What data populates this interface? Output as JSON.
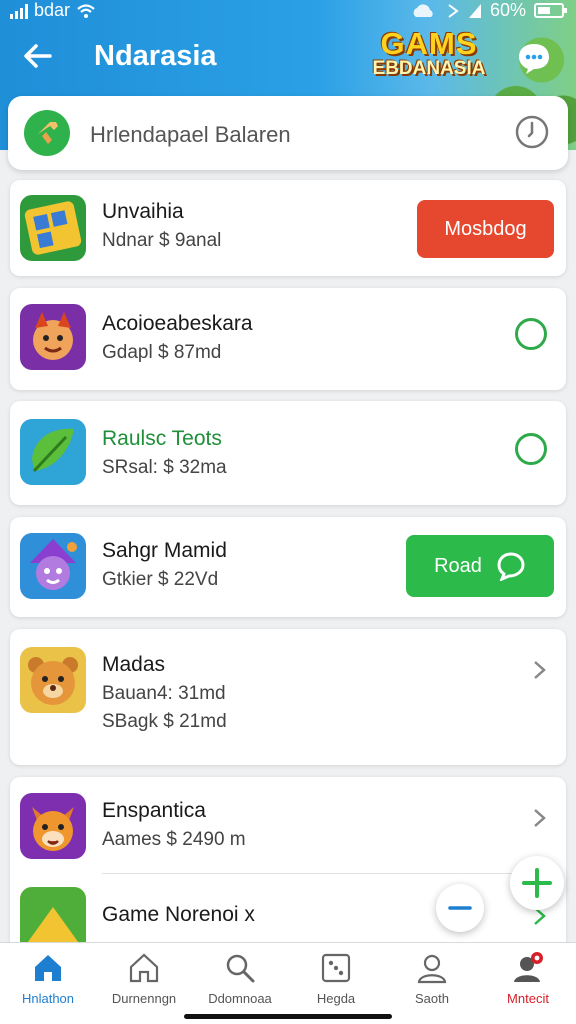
{
  "status_bar": {
    "carrier": "bdar",
    "battery": "60%"
  },
  "header": {
    "title": "Ndarasia",
    "logo_line1": "GAMS",
    "logo_line2": "EBDANASIA"
  },
  "search": {
    "text": "Hrlendapael Balaren"
  },
  "apps": [
    {
      "name": "Unvaihia",
      "meta": [
        "Ndnar $ 9anal"
      ],
      "action": "button",
      "button_label": "Mosbdog",
      "button_color": "#e6482f"
    },
    {
      "name": "Acoioeabeskara",
      "meta": [
        "Gdapl $ 87md"
      ],
      "action": "circle"
    },
    {
      "name": "Raulsc Teots",
      "meta": [
        "SRsal: $ 32ma"
      ],
      "action": "circle",
      "name_color": "#1f8f3a"
    },
    {
      "name": "Sahgr Mamid",
      "meta": [
        "Gtkier $ 22Vd"
      ],
      "action": "button",
      "button_label": "Road",
      "button_color": "#2cba4a"
    },
    {
      "name": "Madas",
      "meta": [
        "Bauan4: 31md",
        "SBagk $ 21md"
      ],
      "action": "chevron"
    },
    {
      "name": "Enspantica",
      "meta": [
        "Aames $ 2490 m"
      ],
      "action": "chevron"
    },
    {
      "name": "Game Norenoi x",
      "meta": [],
      "action": "chevron"
    }
  ],
  "nav": [
    {
      "label": "Hnlathon",
      "icon": "home-icon",
      "state": "active"
    },
    {
      "label": "Durnenngn",
      "icon": "home-outline-icon",
      "state": "normal"
    },
    {
      "label": "Ddomnoaa",
      "icon": "search-icon",
      "state": "normal"
    },
    {
      "label": "Hegda",
      "icon": "dice-icon",
      "state": "normal"
    },
    {
      "label": "Saoth",
      "icon": "profile-icon",
      "state": "normal"
    },
    {
      "label": "Mntecit",
      "icon": "account-alert-icon",
      "state": "alert"
    }
  ],
  "colors": {
    "header_blue": "#2ba0e6",
    "accent_green": "#2cba4a",
    "accent_red": "#e6482f"
  }
}
